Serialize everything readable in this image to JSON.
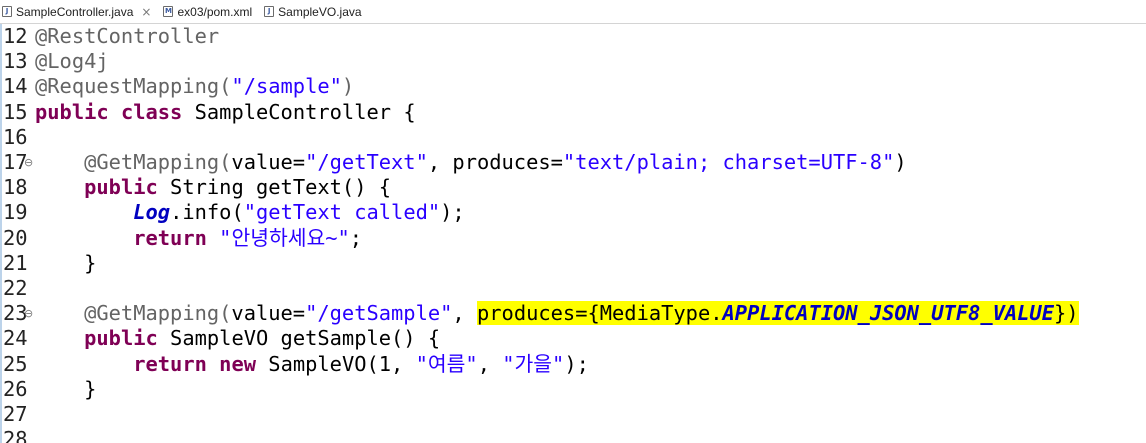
{
  "tabs": [
    {
      "label": "SampleController.java",
      "icon": "java-file-icon",
      "close": "×",
      "active": true
    },
    {
      "label": "ex03/pom.xml",
      "icon": "xml-file-icon",
      "active": false
    },
    {
      "label": "SampleVO.java",
      "icon": "java-file-icon",
      "active": false
    }
  ],
  "lines": [
    {
      "num": "12",
      "tokens": [
        {
          "t": "@RestController",
          "c": "ann"
        }
      ]
    },
    {
      "num": "13",
      "tokens": [
        {
          "t": "@Log4j",
          "c": "ann"
        }
      ]
    },
    {
      "num": "14",
      "tokens": [
        {
          "t": "@RequestMapping(",
          "c": "ann"
        },
        {
          "t": "\"/sample\"",
          "c": "str"
        },
        {
          "t": ")",
          "c": "ann"
        }
      ]
    },
    {
      "num": "15",
      "tokens": [
        {
          "t": "public",
          "c": "kw"
        },
        {
          "t": " ",
          "c": ""
        },
        {
          "t": "class",
          "c": "kw"
        },
        {
          "t": " SampleController {",
          "c": ""
        }
      ]
    },
    {
      "num": "16",
      "tokens": []
    },
    {
      "num": "17",
      "fold": true,
      "tokens": [
        {
          "t": "    @GetMapping(",
          "c": "ann"
        },
        {
          "t": "value=",
          "c": ""
        },
        {
          "t": "\"/getText\"",
          "c": "str"
        },
        {
          "t": ", produces=",
          "c": ""
        },
        {
          "t": "\"text/plain; charset=UTF-8\"",
          "c": "str"
        },
        {
          "t": ")",
          "c": ""
        }
      ]
    },
    {
      "num": "18",
      "tokens": [
        {
          "t": "    ",
          "c": ""
        },
        {
          "t": "public",
          "c": "kw"
        },
        {
          "t": " String getText() {",
          "c": ""
        }
      ]
    },
    {
      "num": "19",
      "tokens": [
        {
          "t": "        ",
          "c": ""
        },
        {
          "t": "Log",
          "c": "static-field"
        },
        {
          "t": ".info(",
          "c": ""
        },
        {
          "t": "\"getText called\"",
          "c": "str"
        },
        {
          "t": ");",
          "c": ""
        }
      ]
    },
    {
      "num": "20",
      "tokens": [
        {
          "t": "        ",
          "c": ""
        },
        {
          "t": "return",
          "c": "kw"
        },
        {
          "t": " ",
          "c": ""
        },
        {
          "t": "\"안녕하세요~\"",
          "c": "str"
        },
        {
          "t": ";",
          "c": ""
        }
      ]
    },
    {
      "num": "21",
      "tokens": [
        {
          "t": "    }",
          "c": ""
        }
      ]
    },
    {
      "num": "22",
      "tokens": []
    },
    {
      "num": "23",
      "fold": true,
      "tokens": [
        {
          "t": "    @GetMapping(",
          "c": "ann"
        },
        {
          "t": "value=",
          "c": ""
        },
        {
          "t": "\"/getSample\"",
          "c": "str"
        },
        {
          "t": ", ",
          "c": ""
        },
        {
          "t": "produces={MediaType.",
          "c": "hl"
        },
        {
          "t": "APPLICATION_JSON_UTF8_VALUE",
          "c": "hl static-field"
        },
        {
          "t": "})",
          "c": "hl"
        }
      ]
    },
    {
      "num": "24",
      "tokens": [
        {
          "t": "    ",
          "c": ""
        },
        {
          "t": "public",
          "c": "kw"
        },
        {
          "t": " SampleVO getSample() {",
          "c": ""
        }
      ]
    },
    {
      "num": "25",
      "tokens": [
        {
          "t": "        ",
          "c": ""
        },
        {
          "t": "return",
          "c": "kw"
        },
        {
          "t": " ",
          "c": ""
        },
        {
          "t": "new",
          "c": "kw"
        },
        {
          "t": " SampleVO(1, ",
          "c": ""
        },
        {
          "t": "\"여름\"",
          "c": "str"
        },
        {
          "t": ", ",
          "c": ""
        },
        {
          "t": "\"가을\"",
          "c": "str"
        },
        {
          "t": ");",
          "c": ""
        }
      ]
    },
    {
      "num": "26",
      "tokens": [
        {
          "t": "    }",
          "c": ""
        }
      ]
    },
    {
      "num": "27",
      "tokens": []
    },
    {
      "num": "28",
      "tokens": []
    }
  ]
}
